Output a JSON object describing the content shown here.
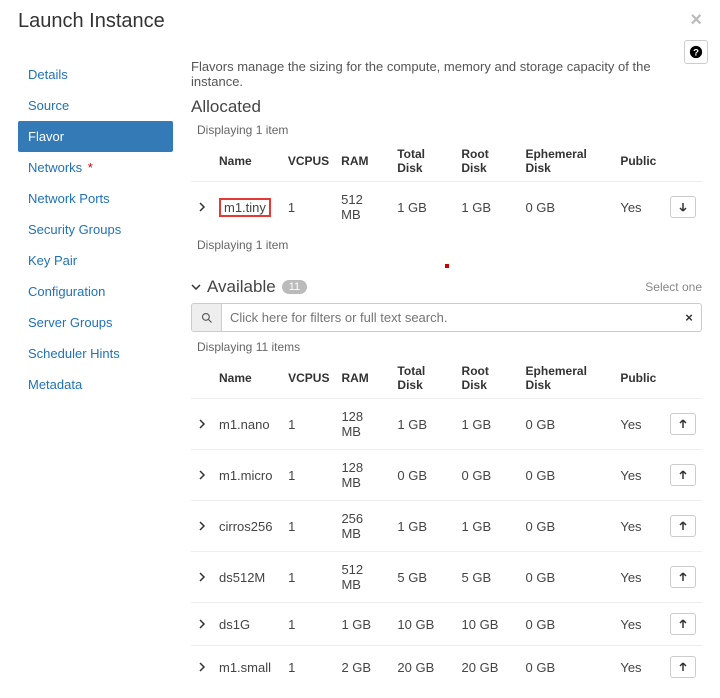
{
  "dialog": {
    "title": "Launch Instance"
  },
  "sidebar": {
    "items": [
      {
        "label": "Details",
        "active": false,
        "required": false
      },
      {
        "label": "Source",
        "active": false,
        "required": false
      },
      {
        "label": "Flavor",
        "active": true,
        "required": false
      },
      {
        "label": "Networks",
        "active": false,
        "required": true
      },
      {
        "label": "Network Ports",
        "active": false,
        "required": false
      },
      {
        "label": "Security Groups",
        "active": false,
        "required": false
      },
      {
        "label": "Key Pair",
        "active": false,
        "required": false
      },
      {
        "label": "Configuration",
        "active": false,
        "required": false
      },
      {
        "label": "Server Groups",
        "active": false,
        "required": false
      },
      {
        "label": "Scheduler Hints",
        "active": false,
        "required": false
      },
      {
        "label": "Metadata",
        "active": false,
        "required": false
      }
    ]
  },
  "main": {
    "description": "Flavors manage the sizing for the compute, memory and storage capacity of the instance.",
    "allocated_title": "Allocated",
    "available_title": "Available",
    "available_count": "11",
    "select_hint": "Select one",
    "displaying_allocated_top": "Displaying 1 item",
    "displaying_allocated_bottom": "Displaying 1 item",
    "displaying_available": "Displaying 11 items",
    "search_placeholder": "Click here for filters or full text search.",
    "columns": {
      "name": "Name",
      "vcpus": "VCPUS",
      "ram": "RAM",
      "total_disk": "Total Disk",
      "root_disk": "Root Disk",
      "ephemeral": "Ephemeral Disk",
      "public": "Public"
    },
    "allocated_rows": [
      {
        "name": "m1.tiny",
        "vcpus": "1",
        "ram": "512 MB",
        "total_disk": "1 GB",
        "root_disk": "1 GB",
        "ephemeral": "0 GB",
        "public": "Yes",
        "highlight": true
      }
    ],
    "available_rows": [
      {
        "name": "m1.nano",
        "vcpus": "1",
        "ram": "128 MB",
        "total_disk": "1 GB",
        "root_disk": "1 GB",
        "ephemeral": "0 GB",
        "public": "Yes"
      },
      {
        "name": "m1.micro",
        "vcpus": "1",
        "ram": "128 MB",
        "total_disk": "0 GB",
        "root_disk": "0 GB",
        "ephemeral": "0 GB",
        "public": "Yes"
      },
      {
        "name": "cirros256",
        "vcpus": "1",
        "ram": "256 MB",
        "total_disk": "1 GB",
        "root_disk": "1 GB",
        "ephemeral": "0 GB",
        "public": "Yes"
      },
      {
        "name": "ds512M",
        "vcpus": "1",
        "ram": "512 MB",
        "total_disk": "5 GB",
        "root_disk": "5 GB",
        "ephemeral": "0 GB",
        "public": "Yes"
      },
      {
        "name": "ds1G",
        "vcpus": "1",
        "ram": "1 GB",
        "total_disk": "10 GB",
        "root_disk": "10 GB",
        "ephemeral": "0 GB",
        "public": "Yes"
      },
      {
        "name": "m1.small",
        "vcpus": "1",
        "ram": "2 GB",
        "total_disk": "20 GB",
        "root_disk": "20 GB",
        "ephemeral": "0 GB",
        "public": "Yes"
      }
    ]
  }
}
